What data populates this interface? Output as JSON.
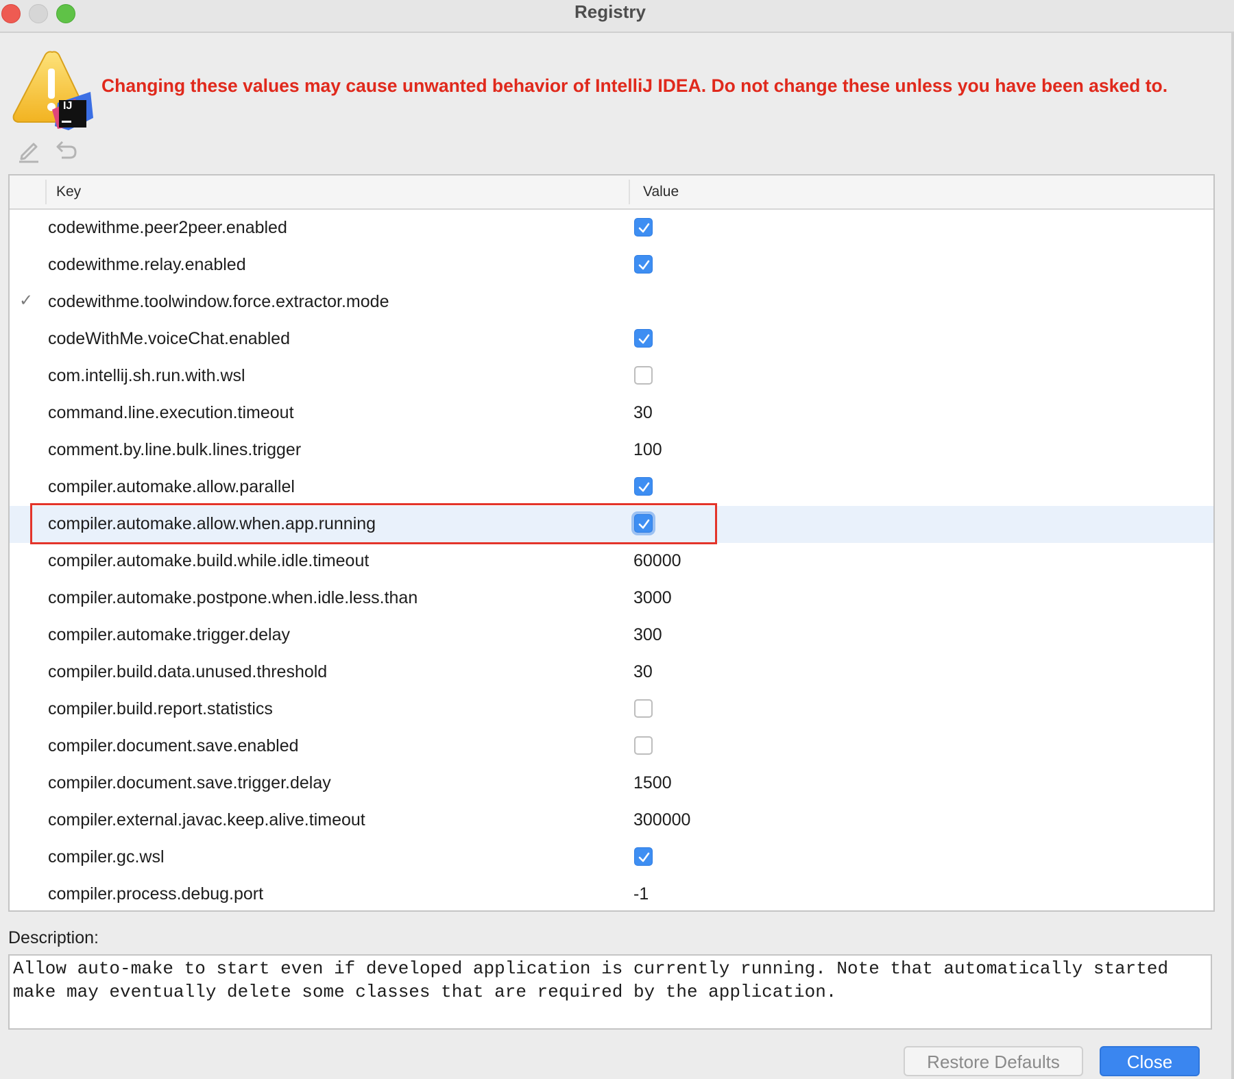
{
  "window": {
    "title": "Registry"
  },
  "warning": {
    "text": "Changing these values may cause unwanted behavior of IntelliJ IDEA. Do not change these unless you have been asked to.",
    "icon": "warning-triangle-intellij-icon",
    "badge": "IJ"
  },
  "toolbar": {
    "edit_icon": "pencil-icon",
    "revert_icon": "undo-icon"
  },
  "table": {
    "columns": {
      "key": "Key",
      "value": "Value"
    },
    "rows": [
      {
        "key": "codewithme.peer2peer.enabled",
        "type": "checkbox",
        "checked": true,
        "modified": false
      },
      {
        "key": "codewithme.relay.enabled",
        "type": "checkbox",
        "checked": true,
        "modified": false
      },
      {
        "key": "codewithme.toolwindow.force.extractor.mode",
        "type": "text",
        "value": "",
        "modified": true,
        "mark": "✓"
      },
      {
        "key": "codeWithMe.voiceChat.enabled",
        "type": "checkbox",
        "checked": true,
        "modified": false
      },
      {
        "key": "com.intellij.sh.run.with.wsl",
        "type": "checkbox",
        "checked": false,
        "modified": false
      },
      {
        "key": "command.line.execution.timeout",
        "type": "text",
        "value": "30",
        "modified": false
      },
      {
        "key": "comment.by.line.bulk.lines.trigger",
        "type": "text",
        "value": "100",
        "modified": false
      },
      {
        "key": "compiler.automake.allow.parallel",
        "type": "checkbox",
        "checked": true,
        "modified": false
      },
      {
        "key": "compiler.automake.allow.when.app.running",
        "type": "checkbox",
        "checked": true,
        "modified": false,
        "selected": true
      },
      {
        "key": "compiler.automake.build.while.idle.timeout",
        "type": "text",
        "value": "60000",
        "modified": false
      },
      {
        "key": "compiler.automake.postpone.when.idle.less.than",
        "type": "text",
        "value": "3000",
        "modified": false
      },
      {
        "key": "compiler.automake.trigger.delay",
        "type": "text",
        "value": "300",
        "modified": false
      },
      {
        "key": "compiler.build.data.unused.threshold",
        "type": "text",
        "value": "30",
        "modified": false
      },
      {
        "key": "compiler.build.report.statistics",
        "type": "checkbox",
        "checked": false,
        "modified": false
      },
      {
        "key": "compiler.document.save.enabled",
        "type": "checkbox",
        "checked": false,
        "modified": false
      },
      {
        "key": "compiler.document.save.trigger.delay",
        "type": "text",
        "value": "1500",
        "modified": false
      },
      {
        "key": "compiler.external.javac.keep.alive.timeout",
        "type": "text",
        "value": "300000",
        "modified": false
      },
      {
        "key": "compiler.gc.wsl",
        "type": "checkbox",
        "checked": true,
        "modified": false
      },
      {
        "key": "compiler.process.debug.port",
        "type": "text",
        "value": "-1",
        "modified": false
      }
    ]
  },
  "description": {
    "label": "Description:",
    "text": "Allow auto-make to start even if developed application is currently running. Note that automatically started make may eventually delete some classes that are required by the application."
  },
  "buttons": {
    "restore_defaults": "Restore Defaults",
    "close": "Close"
  },
  "colors": {
    "warning_text": "#e0291c",
    "checkbox_checked": "#3e8ef2",
    "selected_row": "#e9f1fb",
    "highlight_box": "#e3342a",
    "primary_button": "#3a86f0"
  }
}
